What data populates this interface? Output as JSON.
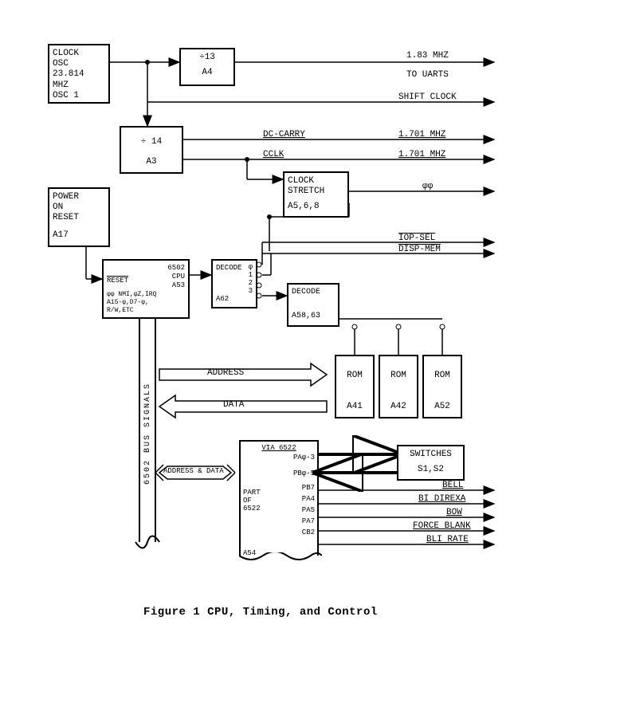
{
  "blocks": {
    "clock_osc": {
      "l1": "CLOCK",
      "l2": "OSC",
      "l3": "23.814",
      "l4": "MHZ",
      "l5": "OSC 1"
    },
    "div13": {
      "label": "÷13",
      "ref": "A4"
    },
    "div14": {
      "label": "÷ 14",
      "ref": "A3"
    },
    "power_reset": {
      "l1": "POWER",
      "l2": "ON",
      "l3": "RESET",
      "l4": "",
      "ref": "A17"
    },
    "clock_stretch": {
      "l1": "CLOCK",
      "l2": "STRETCH",
      "ref": "A5,6,8"
    },
    "cpu": {
      "l1": "6502",
      "l2": "CPU",
      "l3": "A53",
      "l4": "RESET",
      "l5": "φφ NMI,φZ,IRQ",
      "l6": "A15-φ,D7-φ,",
      "l7": "R/W,ETC"
    },
    "decode1": {
      "l1": "DECODE",
      "nums": "φ\n1\n2\n3",
      "ref": "A62"
    },
    "decode2": {
      "l1": "DECODE",
      "ref": "A58,63"
    },
    "rom1": {
      "l1": "ROM",
      "ref": "A41"
    },
    "rom2": {
      "l1": "ROM",
      "ref": "A42"
    },
    "rom3": {
      "l1": "ROM",
      "ref": "A52"
    },
    "switches": {
      "l1": "SWITCHES",
      "l2": "S1,S2"
    },
    "via": {
      "title": "VIA 6522",
      "p1": "PAφ-3",
      "p2": "PBφ-5",
      "p3": "PB7",
      "p4": "PA4",
      "p5": "PA5",
      "p6": "PA7",
      "p7": "CB2",
      "side": "PART\nOF\n6522",
      "ref": "A54"
    }
  },
  "signals": {
    "s1_83mhz": "1.83 MHZ",
    "to_uarts": "TO UARTS",
    "shift_clock": "SHIFT CLOCK",
    "dc_carry": "DC-CARRY",
    "dc_freq": "1.701 MHZ",
    "cclk": "CCLK",
    "cclk_freq": "1.701 MHZ",
    "phi0": "φφ",
    "iop_sel": "IOP-SEL",
    "disp_mem": "DISP-MEM",
    "address": "ADDRESS",
    "data": "DATA",
    "address_data": "ADDRESS & DATA",
    "bell": "BELL",
    "bi_direxa": "BI DIREXA",
    "bow": "BOW",
    "force_blank": "FORCE BLANK",
    "bli_rate": "BLI RATE"
  },
  "sidebus": "6502 BUS SIGNALS",
  "caption": "Figure 1  CPU, Timing, and Control"
}
